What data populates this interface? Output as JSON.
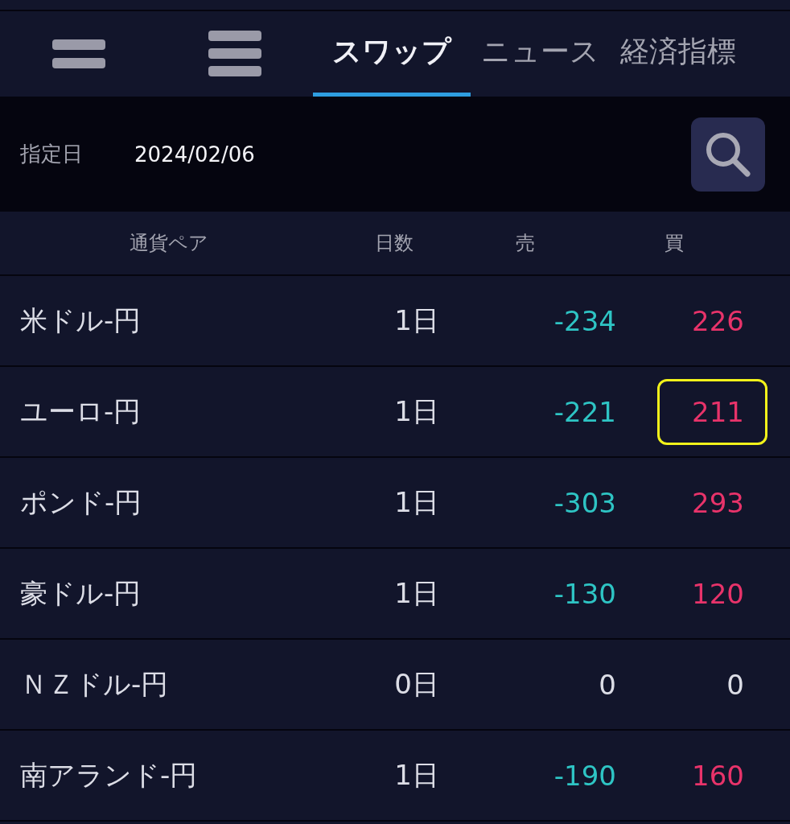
{
  "toolbar": {
    "tabs": [
      {
        "label": "スワップ",
        "selected": true
      },
      {
        "label": "ニュース",
        "selected": false
      },
      {
        "label": "経済指標",
        "selected": false
      }
    ]
  },
  "date_bar": {
    "label": "指定日",
    "value": "2024/02/06"
  },
  "table": {
    "columns": [
      "通貨ペア",
      "日数",
      "売",
      "買"
    ],
    "rows": [
      {
        "pair": "米ドル-円",
        "days": "1日",
        "sell": {
          "text": "-234",
          "color": "#2ec4c4"
        },
        "buy": {
          "text": "226",
          "color": "#e8336a",
          "highlighted": false
        }
      },
      {
        "pair": "ユーロ-円",
        "days": "1日",
        "sell": {
          "text": "-221",
          "color": "#2ec4c4"
        },
        "buy": {
          "text": "211",
          "color": "#e8336a",
          "highlighted": true
        }
      },
      {
        "pair": "ポンド-円",
        "days": "1日",
        "sell": {
          "text": "-303",
          "color": "#2ec4c4"
        },
        "buy": {
          "text": "293",
          "color": "#e8336a",
          "highlighted": false
        }
      },
      {
        "pair": "豪ドル-円",
        "days": "1日",
        "sell": {
          "text": "-130",
          "color": "#2ec4c4"
        },
        "buy": {
          "text": "120",
          "color": "#e8336a",
          "highlighted": false
        }
      },
      {
        "pair": "ＮＺドル-円",
        "days": "0日",
        "sell": {
          "text": "0",
          "color": "#dcdde6"
        },
        "buy": {
          "text": "0",
          "color": "#dcdde6",
          "highlighted": false
        }
      },
      {
        "pair": "南アランド-円",
        "days": "1日",
        "sell": {
          "text": "-190",
          "color": "#2ec4c4"
        },
        "buy": {
          "text": "160",
          "color": "#e8336a",
          "highlighted": false
        }
      }
    ]
  }
}
